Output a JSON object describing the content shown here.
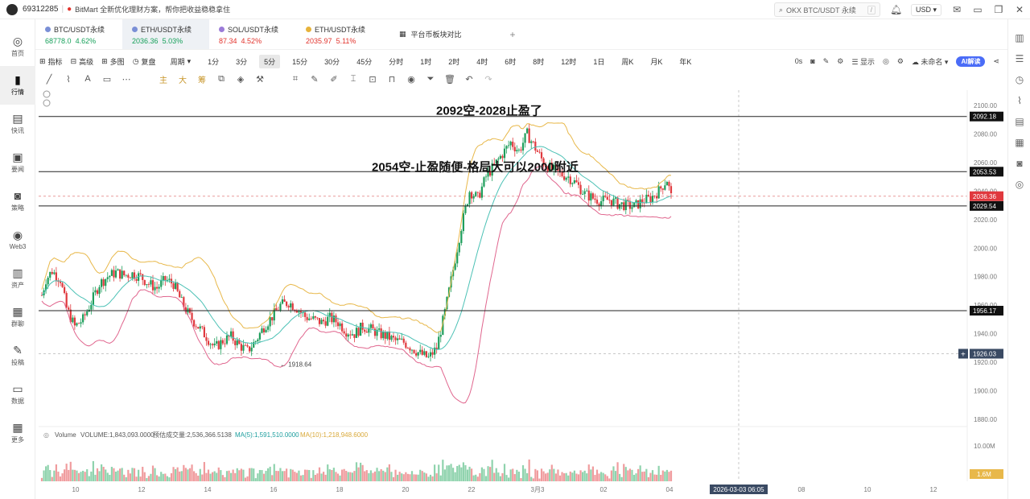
{
  "titlebar": {
    "account_id": "69312285",
    "promo_text": "BitMart 全新优化理财方案，帮你把收益稳稳拿住",
    "search_placeholder": "OKX BTC/USDT 永续",
    "search_hint": "/",
    "currency": "USD",
    "icons": [
      "bell-icon",
      "mail-icon",
      "minimize-icon",
      "maximize-icon",
      "close-icon"
    ]
  },
  "sidebar": {
    "items": [
      {
        "label": "首页",
        "icon": "home-icon",
        "glyph": "◎"
      },
      {
        "label": "行情",
        "icon": "chart-bar-icon",
        "glyph": "▮",
        "active": true
      },
      {
        "label": "快讯",
        "icon": "news-icon",
        "glyph": "▤"
      },
      {
        "label": "要闻",
        "icon": "article-icon",
        "glyph": "▣"
      },
      {
        "label": "策略",
        "icon": "robot-icon",
        "glyph": "◙"
      },
      {
        "label": "Web3",
        "icon": "web3-icon",
        "glyph": "◉"
      },
      {
        "label": "资产",
        "icon": "wallet-icon",
        "glyph": "▥"
      },
      {
        "label": "群聊",
        "icon": "chat-icon",
        "glyph": "▦"
      },
      {
        "label": "投稿",
        "icon": "edit-icon",
        "glyph": "✎"
      },
      {
        "label": "数据",
        "icon": "monitor-icon",
        "glyph": "▭"
      },
      {
        "label": "更多",
        "icon": "grid-icon",
        "glyph": "▦"
      }
    ]
  },
  "tabs": {
    "items": [
      {
        "name": "BTC/USDT永续",
        "price": "68778.0",
        "change": "4.62%",
        "dir": "up"
      },
      {
        "name": "ETH/USDT永续",
        "price": "2036.36",
        "change": "5.03%",
        "dir": "up",
        "active": true
      },
      {
        "name": "SOL/USDT永续",
        "price": "87.34",
        "change": "4.52%",
        "dir": "dn"
      },
      {
        "name": "ETH/USDT永续",
        "price": "2035.97",
        "change": "5.11%",
        "dir": "dn"
      }
    ],
    "compare_label": "平台币板块对比",
    "add_label": "+"
  },
  "toolbar1": {
    "left": [
      "指标",
      "高级",
      "多图",
      "复盘",
      "周期"
    ],
    "intervals": [
      "1分",
      "3分",
      "5分",
      "15分",
      "30分",
      "45分",
      "分时",
      "1时",
      "2时",
      "4时",
      "6时",
      "8时",
      "12时",
      "1日",
      "周K",
      "月K",
      "年K"
    ],
    "active_interval": "5分",
    "right": {
      "timer": "0s",
      "display": "显示",
      "unnamed": "未命名",
      "ai": "AI解读"
    }
  },
  "toolbar2": {
    "labels": [
      "主",
      "大",
      "筹"
    ]
  },
  "chart_data": {
    "type": "candlestick",
    "title": "",
    "y_axis": {
      "ticks": [
        1880,
        1900,
        1920,
        1940,
        1960,
        1980,
        2000,
        2020,
        2040,
        2060,
        2080,
        2100
      ],
      "ylim": [
        1875,
        2105
      ]
    },
    "x_axis": {
      "ticks": [
        "10",
        "12",
        "14",
        "16",
        "18",
        "20",
        "22",
        "3月3",
        "02",
        "04",
        "08",
        "10",
        "12"
      ],
      "cursor_label": "2026-03-03 06:05"
    },
    "horizontal_lines": [
      {
        "value": 2092.18,
        "label": "2092.18",
        "style": "solid"
      },
      {
        "value": 2053.53,
        "label": "2053.53",
        "style": "solid"
      },
      {
        "value": 2029.54,
        "label": "2029.54",
        "style": "solid"
      },
      {
        "value": 1956.17,
        "label": "1956.17",
        "style": "solid"
      }
    ],
    "current_price": {
      "value": 2036.36,
      "label": "2036.36"
    },
    "crosshair_price": {
      "value": 1926.03,
      "label": "1926.03"
    },
    "low_marker": {
      "value": 1918.64,
      "label": "← 1918.64"
    },
    "annotations": [
      "2092空-2028止盈了",
      "2054空-止盈随便-格局大可以2000附近"
    ],
    "volume": {
      "label": "Volume",
      "value": "VOLUME:1,843,093.0000",
      "estimate": "预估成交量:2,536,366.5138",
      "ma5": "MA(5):1,591,510.0000",
      "ma10": "MA(10):1,218,948.6000",
      "axis_label": "10.00M",
      "current_label": "1.6M"
    },
    "path_keypoints": [
      [
        0,
        1967
      ],
      [
        2,
        1978
      ],
      [
        5,
        1984
      ],
      [
        9,
        1978
      ],
      [
        12,
        1958
      ],
      [
        16,
        1945
      ],
      [
        20,
        1950
      ],
      [
        24,
        1962
      ],
      [
        28,
        1975
      ],
      [
        32,
        1980
      ],
      [
        36,
        1983
      ],
      [
        40,
        1981
      ],
      [
        44,
        1982
      ],
      [
        48,
        1980
      ],
      [
        52,
        1975
      ],
      [
        56,
        1972
      ],
      [
        60,
        1978
      ],
      [
        64,
        1975
      ],
      [
        68,
        1962
      ],
      [
        72,
        1952
      ],
      [
        76,
        1945
      ],
      [
        80,
        1938
      ],
      [
        84,
        1930
      ],
      [
        88,
        1935
      ],
      [
        92,
        1938
      ],
      [
        96,
        1932
      ],
      [
        100,
        1928
      ],
      [
        104,
        1935
      ],
      [
        108,
        1945
      ],
      [
        112,
        1952
      ],
      [
        116,
        1960
      ],
      [
        120,
        1962
      ],
      [
        124,
        1958
      ],
      [
        128,
        1952
      ],
      [
        132,
        1950
      ],
      [
        136,
        1948
      ],
      [
        140,
        1951
      ],
      [
        144,
        1948
      ],
      [
        148,
        1942
      ],
      [
        152,
        1940
      ],
      [
        156,
        1945
      ],
      [
        160,
        1943
      ],
      [
        164,
        1940
      ],
      [
        168,
        1938
      ],
      [
        172,
        1935
      ],
      [
        176,
        1934
      ],
      [
        180,
        1930
      ],
      [
        184,
        1926
      ],
      [
        188,
        1923
      ],
      [
        192,
        1930
      ],
      [
        196,
        1955
      ],
      [
        200,
        1985
      ],
      [
        204,
        2015
      ],
      [
        208,
        2040
      ],
      [
        212,
        2035
      ],
      [
        216,
        2050
      ],
      [
        220,
        2058
      ],
      [
        224,
        2066
      ],
      [
        228,
        2074
      ],
      [
        232,
        2068
      ],
      [
        236,
        2080
      ],
      [
        240,
        2070
      ],
      [
        244,
        2060
      ],
      [
        248,
        2055
      ],
      [
        252,
        2052
      ],
      [
        256,
        2050
      ],
      [
        260,
        2045
      ],
      [
        264,
        2038
      ],
      [
        268,
        2035
      ],
      [
        272,
        2033
      ],
      [
        276,
        2034
      ],
      [
        280,
        2031
      ],
      [
        284,
        2030
      ],
      [
        288,
        2029
      ],
      [
        292,
        2033
      ],
      [
        296,
        2035
      ],
      [
        300,
        2040
      ],
      [
        304,
        2048
      ],
      [
        306,
        2036
      ]
    ]
  }
}
